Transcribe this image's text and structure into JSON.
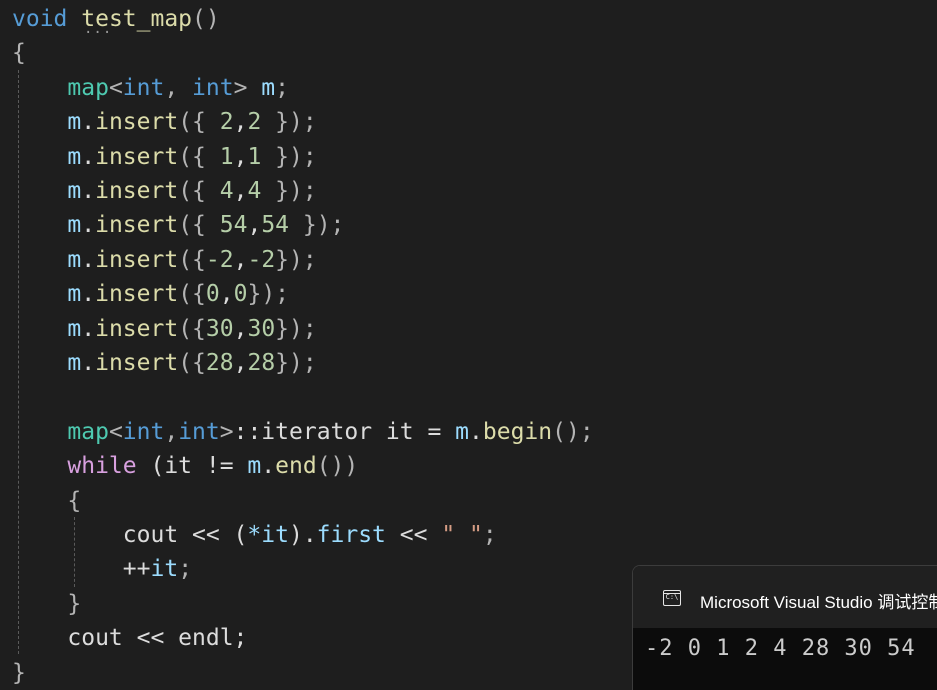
{
  "code": {
    "lines": [
      [
        {
          "t": "void",
          "c": "kw"
        },
        {
          "t": " "
        },
        {
          "t": "test_map",
          "c": "fn"
        },
        {
          "t": "()",
          "c": "punc"
        }
      ],
      [
        {
          "t": "{",
          "c": "punc"
        }
      ],
      [
        {
          "t": "    "
        },
        {
          "t": "map",
          "c": "tmpl"
        },
        {
          "t": "<",
          "c": "punc"
        },
        {
          "t": "int",
          "c": "kw"
        },
        {
          "t": ", ",
          "c": "punc"
        },
        {
          "t": "int",
          "c": "kw"
        },
        {
          "t": ">",
          "c": "punc"
        },
        {
          "t": " m",
          "c": "var"
        },
        {
          "t": ";",
          "c": "punc"
        }
      ],
      [
        {
          "t": "    "
        },
        {
          "t": "m",
          "c": "var"
        },
        {
          "t": "."
        },
        {
          "t": "insert",
          "c": "fn"
        },
        {
          "t": "({ ",
          "c": "punc"
        },
        {
          "t": "2",
          "c": "num"
        },
        {
          "t": ","
        },
        {
          "t": "2",
          "c": "num"
        },
        {
          "t": " });",
          "c": "punc"
        }
      ],
      [
        {
          "t": "    "
        },
        {
          "t": "m",
          "c": "var"
        },
        {
          "t": "."
        },
        {
          "t": "insert",
          "c": "fn"
        },
        {
          "t": "({ ",
          "c": "punc"
        },
        {
          "t": "1",
          "c": "num"
        },
        {
          "t": ","
        },
        {
          "t": "1",
          "c": "num"
        },
        {
          "t": " });",
          "c": "punc"
        }
      ],
      [
        {
          "t": "    "
        },
        {
          "t": "m",
          "c": "var"
        },
        {
          "t": "."
        },
        {
          "t": "insert",
          "c": "fn"
        },
        {
          "t": "({ ",
          "c": "punc"
        },
        {
          "t": "4",
          "c": "num"
        },
        {
          "t": ","
        },
        {
          "t": "4",
          "c": "num"
        },
        {
          "t": " });",
          "c": "punc"
        }
      ],
      [
        {
          "t": "    "
        },
        {
          "t": "m",
          "c": "var"
        },
        {
          "t": "."
        },
        {
          "t": "insert",
          "c": "fn"
        },
        {
          "t": "({ ",
          "c": "punc"
        },
        {
          "t": "54",
          "c": "num"
        },
        {
          "t": ","
        },
        {
          "t": "54",
          "c": "num"
        },
        {
          "t": " });",
          "c": "punc"
        }
      ],
      [
        {
          "t": "    "
        },
        {
          "t": "m",
          "c": "var"
        },
        {
          "t": "."
        },
        {
          "t": "insert",
          "c": "fn"
        },
        {
          "t": "({",
          "c": "punc"
        },
        {
          "t": "-2",
          "c": "num"
        },
        {
          "t": ","
        },
        {
          "t": "-2",
          "c": "num"
        },
        {
          "t": "});",
          "c": "punc"
        }
      ],
      [
        {
          "t": "    "
        },
        {
          "t": "m",
          "c": "var"
        },
        {
          "t": "."
        },
        {
          "t": "insert",
          "c": "fn"
        },
        {
          "t": "({",
          "c": "punc"
        },
        {
          "t": "0",
          "c": "num"
        },
        {
          "t": ","
        },
        {
          "t": "0",
          "c": "num"
        },
        {
          "t": "});",
          "c": "punc"
        }
      ],
      [
        {
          "t": "    "
        },
        {
          "t": "m",
          "c": "var"
        },
        {
          "t": "."
        },
        {
          "t": "insert",
          "c": "fn"
        },
        {
          "t": "({",
          "c": "punc"
        },
        {
          "t": "30",
          "c": "num"
        },
        {
          "t": ","
        },
        {
          "t": "30",
          "c": "num"
        },
        {
          "t": "});",
          "c": "punc"
        }
      ],
      [
        {
          "t": "    "
        },
        {
          "t": "m",
          "c": "var"
        },
        {
          "t": "."
        },
        {
          "t": "insert",
          "c": "fn"
        },
        {
          "t": "({",
          "c": "punc"
        },
        {
          "t": "28",
          "c": "num"
        },
        {
          "t": ","
        },
        {
          "t": "28",
          "c": "num"
        },
        {
          "t": "});",
          "c": "punc"
        }
      ],
      [],
      [
        {
          "t": "    "
        },
        {
          "t": "map",
          "c": "tmpl"
        },
        {
          "t": "<",
          "c": "punc"
        },
        {
          "t": "int",
          "c": "kw"
        },
        {
          "t": ",",
          "c": "punc"
        },
        {
          "t": "int",
          "c": "kw"
        },
        {
          "t": ">",
          "c": "punc"
        },
        {
          "t": "::iterator it = "
        },
        {
          "t": "m",
          "c": "var"
        },
        {
          "t": "."
        },
        {
          "t": "begin",
          "c": "fn"
        },
        {
          "t": "();",
          "c": "punc"
        }
      ],
      [
        {
          "t": "    "
        },
        {
          "t": "while",
          "c": "ctl"
        },
        {
          "t": " (it != "
        },
        {
          "t": "m",
          "c": "var"
        },
        {
          "t": "."
        },
        {
          "t": "end",
          "c": "fn"
        },
        {
          "t": "())",
          "c": "punc"
        }
      ],
      [
        {
          "t": "    "
        },
        {
          "t": "{",
          "c": "punc"
        }
      ],
      [
        {
          "t": "        cout << ("
        },
        {
          "t": "*",
          "c": "var"
        },
        {
          "t": "it",
          "c": "var"
        },
        {
          "t": ")."
        },
        {
          "t": "first",
          "c": "var"
        },
        {
          "t": " << "
        },
        {
          "t": "\" \"",
          "c": "str"
        },
        {
          "t": ";",
          "c": "punc"
        }
      ],
      [
        {
          "t": "        ++"
        },
        {
          "t": "it",
          "c": "var"
        },
        {
          "t": ";",
          "c": "punc"
        }
      ],
      [
        {
          "t": "    "
        },
        {
          "t": "}",
          "c": "punc"
        }
      ],
      [
        {
          "t": "    cout << endl;"
        }
      ],
      [
        {
          "t": "}",
          "c": "punc"
        }
      ]
    ]
  },
  "console": {
    "icon": "terminal-icon",
    "icon_text": "C:\\",
    "title": "Microsoft Visual Studio 调试控制台",
    "output": "-2 0 1 2 4 28 30 54"
  }
}
